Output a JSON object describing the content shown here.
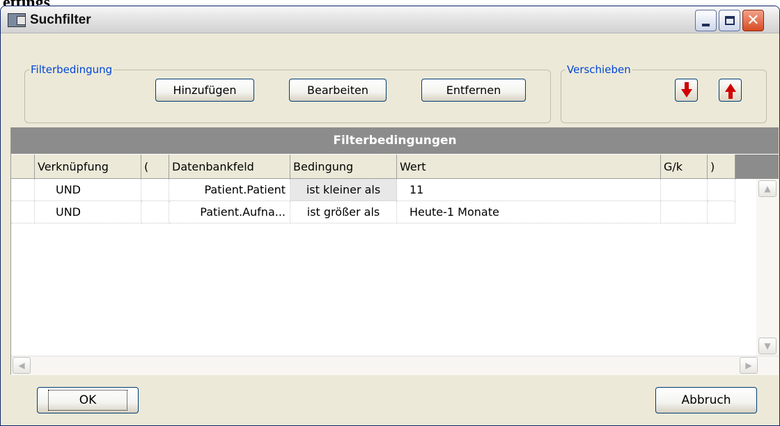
{
  "top_label": "ettings",
  "window": {
    "title": "Suchfilter"
  },
  "groups": {
    "filter_label": "Filterbedingung",
    "buttons": {
      "add": "Hinzufügen",
      "edit": "Bearbeiten",
      "remove": "Entfernen"
    },
    "move_label": "Verschieben"
  },
  "grid": {
    "caption": "Filterbedingungen",
    "columns": [
      "Verknüpfung",
      "(",
      "Datenbankfeld",
      "Bedingung",
      "Wert",
      "G/k",
      ")"
    ],
    "rows": [
      [
        "UND",
        "",
        "Patient.Patient",
        "ist kleiner als",
        "11",
        "",
        ""
      ],
      [
        "UND",
        "",
        "Patient.Aufna...",
        "ist größer als",
        "Heute-1 Monate",
        "",
        ""
      ]
    ]
  },
  "footer": {
    "ok": "OK",
    "cancel": "Abbruch"
  },
  "colors": {
    "accent": "#0046d5",
    "grid_header": "#8c8c8c",
    "arrow": "#d00000",
    "close": "#d84a22"
  }
}
